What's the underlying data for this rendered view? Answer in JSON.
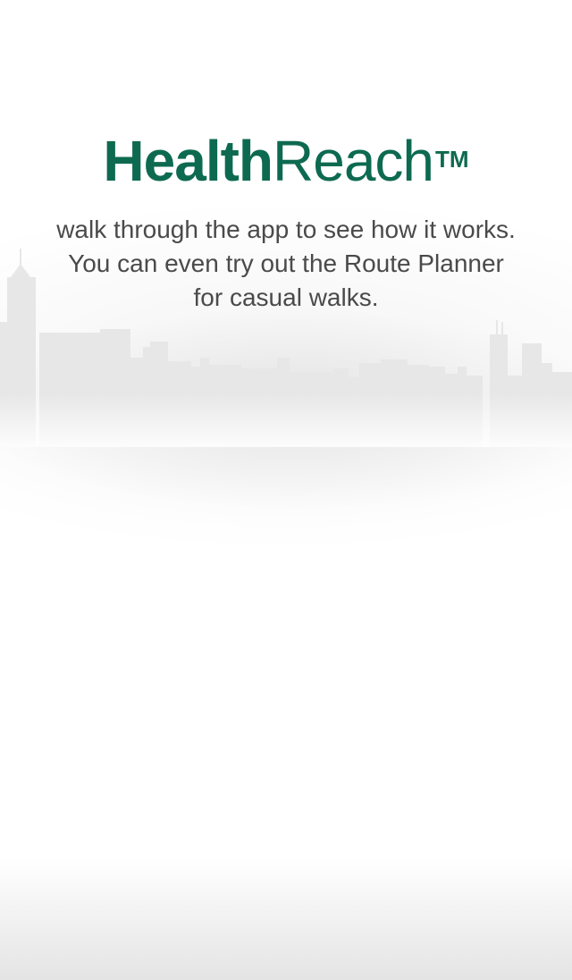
{
  "logo": {
    "primary": "Health",
    "secondary": "Reach",
    "trademark": "TM"
  },
  "intro": {
    "text": "walk through the app to see how it works. You can even try out the Route Planner for casual walks."
  },
  "colors": {
    "brand": "#0d6a50",
    "body_text": "#4a4a4a",
    "skyline": "#e6e6e6"
  }
}
